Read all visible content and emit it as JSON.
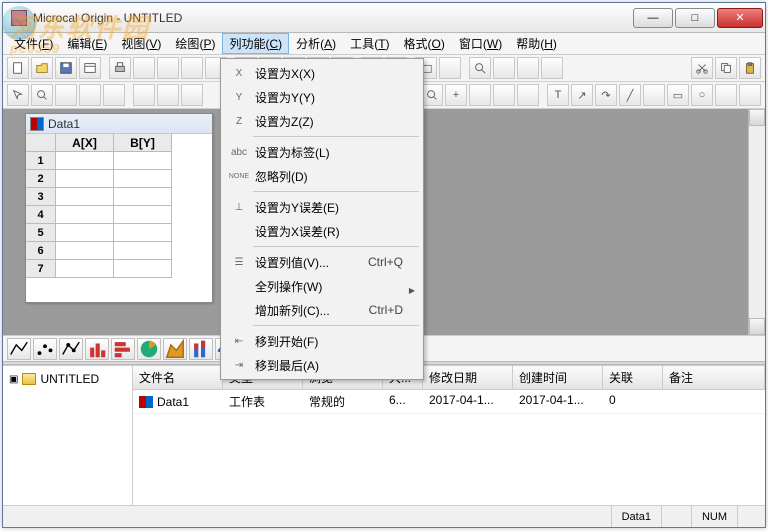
{
  "window": {
    "title": "Microcal Origin - UNTITLED"
  },
  "menubar": [
    {
      "label": "文件",
      "key": "F"
    },
    {
      "label": "编辑",
      "key": "E"
    },
    {
      "label": "视图",
      "key": "V"
    },
    {
      "label": "绘图",
      "key": "P"
    },
    {
      "label": "列功能",
      "key": "C",
      "open": true
    },
    {
      "label": "分析",
      "key": "A"
    },
    {
      "label": "工具",
      "key": "T"
    },
    {
      "label": "格式",
      "key": "O"
    },
    {
      "label": "窗口",
      "key": "W"
    },
    {
      "label": "帮助",
      "key": "H"
    }
  ],
  "dropdown": [
    {
      "icon": "X",
      "label": "设置为X(X)"
    },
    {
      "icon": "Y",
      "label": "设置为Y(Y)"
    },
    {
      "icon": "Z",
      "label": "设置为Z(Z)"
    },
    {
      "sep": true
    },
    {
      "icon": "abc",
      "label": "设置为标签(L)"
    },
    {
      "icon": "NONE",
      "label": "忽略列(D)"
    },
    {
      "sep": true
    },
    {
      "icon": "⊥",
      "label": "设置为Y误差(E)"
    },
    {
      "icon": "",
      "label": "设置为X误差(R)"
    },
    {
      "sep": true
    },
    {
      "icon": "☰",
      "label": "设置列值(V)...",
      "accel": "Ctrl+Q"
    },
    {
      "icon": "",
      "label": "全列操作(W)",
      "sub": true
    },
    {
      "icon": "",
      "label": "增加新列(C)...",
      "accel": "Ctrl+D"
    },
    {
      "sep": true
    },
    {
      "icon": "⇤",
      "label": "移到开始(F)"
    },
    {
      "icon": "⇥",
      "label": "移到最后(A)"
    }
  ],
  "child_window": {
    "title": "Data1",
    "columns": [
      "A[X]",
      "B[Y]"
    ],
    "rows": [
      "1",
      "2",
      "3",
      "4",
      "5",
      "6",
      "7"
    ]
  },
  "tree": {
    "root": "UNTITLED"
  },
  "list": {
    "headers": [
      "文件名",
      "类型",
      "浏览",
      "大...",
      "修改日期",
      "创建时间",
      "关联",
      "备注"
    ],
    "row": {
      "name": "Data1",
      "type": "工作表",
      "view": "常规的",
      "size": "6...",
      "mdate": "2017-04-1...",
      "cdate": "2017-04-1...",
      "link": "0",
      "memo": ""
    }
  },
  "statusbar": {
    "doc": "Data1",
    "num": "NUM"
  },
  "watermark": "河东软件园",
  "watermark_sub": "pc0359"
}
